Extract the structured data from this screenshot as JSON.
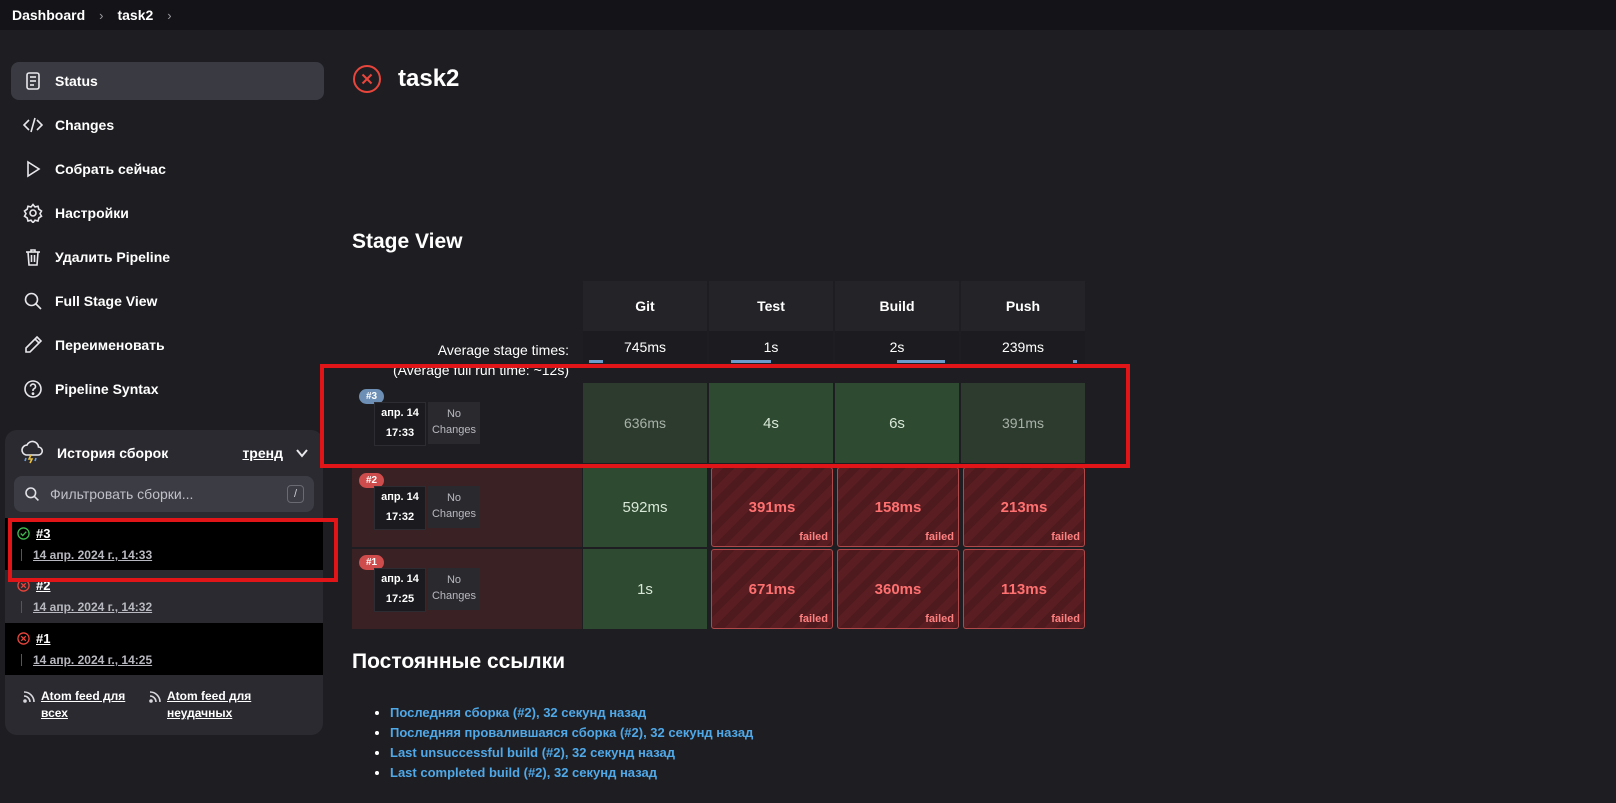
{
  "breadcrumb": {
    "items": [
      "Dashboard",
      "task2"
    ]
  },
  "sidebar": {
    "items": [
      {
        "label": "Status",
        "icon": "document-icon"
      },
      {
        "label": "Changes",
        "icon": "code-icon"
      },
      {
        "label": "Собрать сейчас",
        "icon": "play-icon"
      },
      {
        "label": "Настройки",
        "icon": "gear-icon"
      },
      {
        "label": "Удалить Pipeline",
        "icon": "trash-icon"
      },
      {
        "label": "Full Stage View",
        "icon": "search-icon"
      },
      {
        "label": "Переименовать",
        "icon": "pencil-icon"
      },
      {
        "label": "Pipeline Syntax",
        "icon": "help-icon"
      }
    ]
  },
  "history": {
    "title": "История сборок",
    "trend": "тренд",
    "filter_placeholder": "Фильтровать сборки...",
    "shortcut": "/",
    "builds": [
      {
        "num": "#3",
        "date": "14 апр. 2024 г., 14:33",
        "status": "success"
      },
      {
        "num": "#2",
        "date": "14 апр. 2024 г., 14:32",
        "status": "failed"
      },
      {
        "num": "#1",
        "date": "14 апр. 2024 г., 14:25",
        "status": "failed"
      }
    ],
    "atom_all": "Atom feed для всех",
    "atom_failed": "Atom feed для неудачных"
  },
  "page": {
    "title": "task2"
  },
  "stage_view": {
    "title": "Stage View",
    "avg_label": "Average stage times:",
    "avg_full": "(Average full run time: ~12s)",
    "stages": [
      "Git",
      "Test",
      "Build",
      "Push"
    ],
    "avg_times": [
      "745ms",
      "1s",
      "2s",
      "239ms"
    ],
    "runs": [
      {
        "badge": "#3",
        "date": "апр. 14",
        "time": "17:33",
        "changes": "No Changes",
        "cells": [
          "636ms",
          "4s",
          "6s",
          "391ms"
        ],
        "failed": [
          false,
          false,
          false,
          false
        ]
      },
      {
        "badge": "#2",
        "date": "апр. 14",
        "time": "17:32",
        "changes": "No Changes",
        "cells": [
          "592ms",
          "391ms",
          "158ms",
          "213ms"
        ],
        "failed": [
          false,
          true,
          true,
          true
        ]
      },
      {
        "badge": "#1",
        "date": "апр. 14",
        "time": "17:25",
        "changes": "No Changes",
        "cells": [
          "1s",
          "671ms",
          "360ms",
          "113ms"
        ],
        "failed": [
          false,
          true,
          true,
          true
        ]
      }
    ],
    "failed_label": "failed"
  },
  "permalinks": {
    "title": "Постоянные ссылки",
    "items": [
      "Последняя сборка (#2), 32 секунд назад",
      "Последняя провалившаяся сборка (#2), 32 секунд назад",
      "Last unsuccessful build (#2), 32 секунд назад",
      "Last completed build (#2), 32 секунд назад"
    ]
  },
  "colors": {
    "fail_red": "#e8453c",
    "success_green": "#3fb950",
    "accent_blue": "#4fa8e8",
    "highlight": "#e11418"
  }
}
